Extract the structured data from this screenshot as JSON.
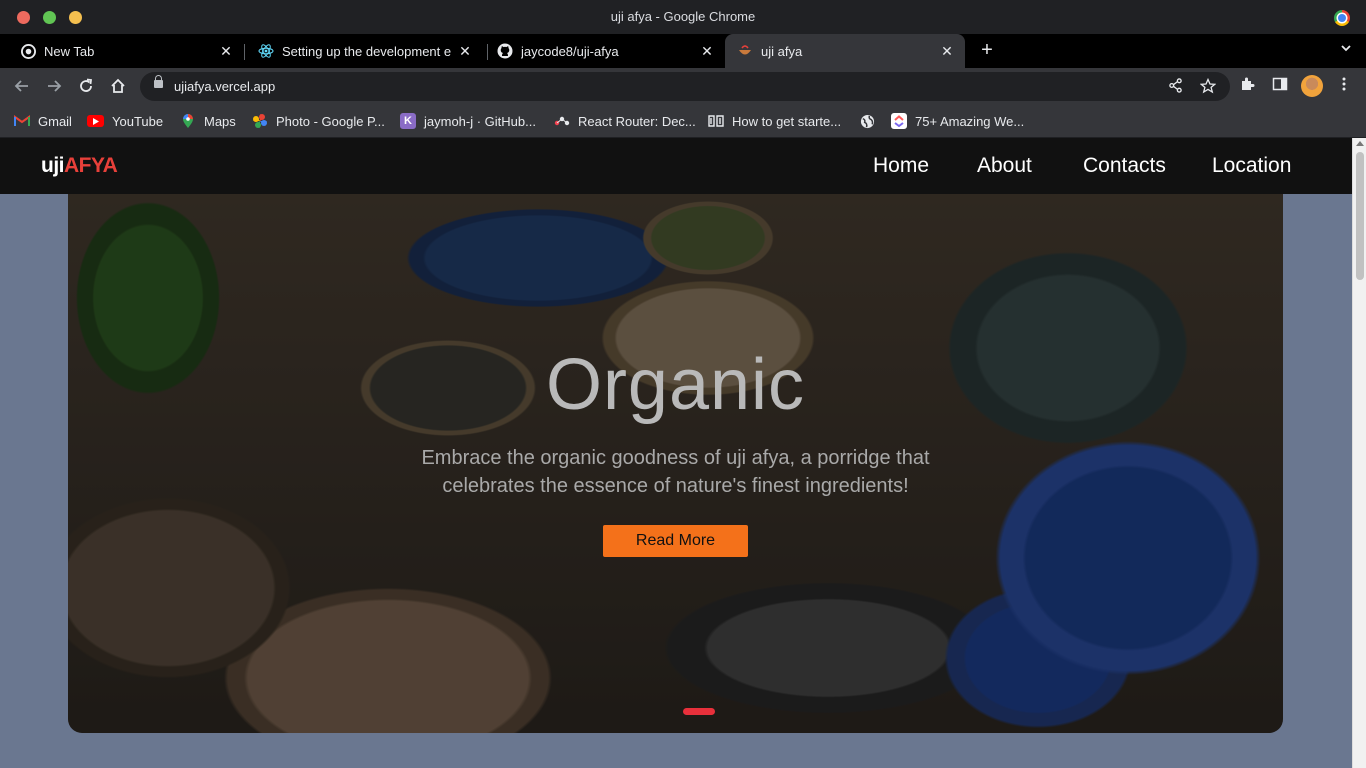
{
  "window": {
    "title": "uji afya - Google Chrome"
  },
  "tabs": [
    {
      "label": "New Tab",
      "icon": "chrome-icon"
    },
    {
      "label": "Setting up the development e",
      "icon": "react-icon"
    },
    {
      "label": "jaycode8/uji-afya",
      "icon": "github-icon"
    },
    {
      "label": "uji afya",
      "icon": "uji-afya-favicon",
      "active": true
    }
  ],
  "toolbar": {
    "url": "ujiafya.vercel.app"
  },
  "bookmarks": [
    {
      "label": "Gmail",
      "icon": "gmail-icon"
    },
    {
      "label": "YouTube",
      "icon": "youtube-icon"
    },
    {
      "label": "Maps",
      "icon": "maps-icon"
    },
    {
      "label": "Photo - Google P...",
      "icon": "photos-icon"
    },
    {
      "label": "jaymoh-j · GitHub...",
      "icon": "heroku-icon"
    },
    {
      "label": "React Router: Dec...",
      "icon": "react-router-icon"
    },
    {
      "label": "How to get starte...",
      "icon": "docs-icon"
    },
    {
      "label": "",
      "icon": "globe-icon"
    },
    {
      "label": "75+ Amazing We...",
      "icon": "clickup-icon"
    }
  ],
  "site": {
    "logo_part1": "uji",
    "logo_part2": "AFYA",
    "nav": [
      "Home",
      "About",
      "Contacts",
      "Location"
    ],
    "hero": {
      "title": "Organic",
      "text": "Embrace the organic goodness of uji afya, a porridge that celebrates the essence of nature's finest ingredients!",
      "button": "Read More"
    }
  },
  "colors": {
    "brand_accent": "#e8403a",
    "button": "#f4711a",
    "indicator": "#e8303b",
    "page_bg": "#6a7790"
  }
}
